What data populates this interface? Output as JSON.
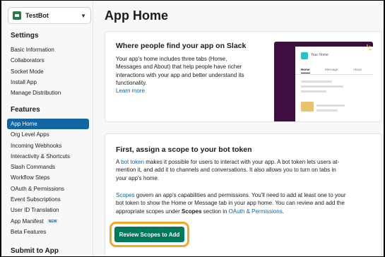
{
  "app": {
    "name": "TestBot"
  },
  "sidebar": {
    "settings_title": "Settings",
    "settings_items": [
      "Basic Information",
      "Collaborators",
      "Socket Mode",
      "Install App",
      "Manage Distribution"
    ],
    "features_title": "Features",
    "features_items": [
      {
        "label": "App Home",
        "active": true
      },
      {
        "label": "Org Level Apps"
      },
      {
        "label": "Incoming Webhooks"
      },
      {
        "label": "Interactivity & Shortcuts"
      },
      {
        "label": "Slash Commands"
      },
      {
        "label": "Workflow Steps"
      },
      {
        "label": "OAuth & Permissions"
      },
      {
        "label": "Event Subscriptions"
      },
      {
        "label": "User ID Translation"
      },
      {
        "label": "App Manifest",
        "badge": "NEW"
      },
      {
        "label": "Beta Features"
      }
    ],
    "submit_title": "Submit to App"
  },
  "main": {
    "title": "App Home",
    "card1": {
      "title": "Where people find your app on Slack",
      "lines": [
        "Your app's home includes three tabs (Home,",
        "Messages and About) that help people have richer",
        "interactions with your app and better understand its",
        "functionality."
      ],
      "learn_more": "Learn more",
      "preview": {
        "name": "Your Home",
        "tabs": [
          "Home",
          "Message",
          "About"
        ]
      }
    },
    "card2": {
      "title": "First, assign a scope to your bot token",
      "para1": {
        "l1_pre": "A ",
        "l1_link": "bot token",
        "l1_post": " makes it possible for users to interact with your app. A bot token lets users at-",
        "l2": "mention it, and add it to channels and conversations. It also allows you to turn on tabs in",
        "l3": "your app's home."
      },
      "para2": {
        "l1_link": "Scopes",
        "l1_post": " govern an app's capabilities and permissions. You'll need to add at least one to your",
        "l2": "bot token to show the Home or Message tab in your app home. You can review and add the",
        "l3_pre": "appropriate scopes under ",
        "l3_bold": "Scopes",
        "l3_mid": " section in ",
        "l3_link": "OAuth & Permissions",
        "l3_post": "."
      },
      "button": "Review Scopes to Add"
    }
  },
  "colors": {
    "accent": "#1264a3",
    "button": "#007a5a",
    "highlight": "#f5a623",
    "preview_bg": "#3f0e40"
  }
}
